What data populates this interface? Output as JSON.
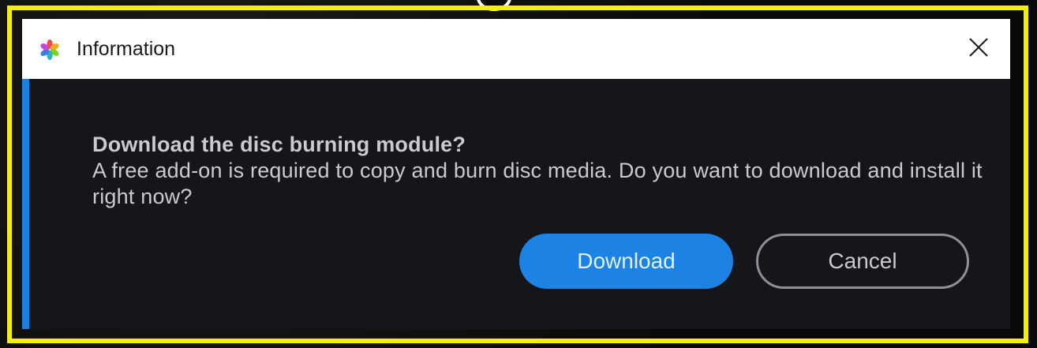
{
  "dialog": {
    "title": "Information",
    "heading": "Download the disc burning module?",
    "message": "A free add-on is required to copy and burn disc media. Do you want to download and install it right now?",
    "download_label": "Download",
    "cancel_label": "Cancel"
  },
  "icons": {
    "app": "app-logo-icon",
    "close": "close-icon"
  },
  "colors": {
    "highlight_frame": "#f3f000",
    "accent": "#1e7fe0",
    "primary_button": "#1c82e3",
    "dialog_background": "#15161a",
    "titlebar_background": "#ffffff"
  }
}
